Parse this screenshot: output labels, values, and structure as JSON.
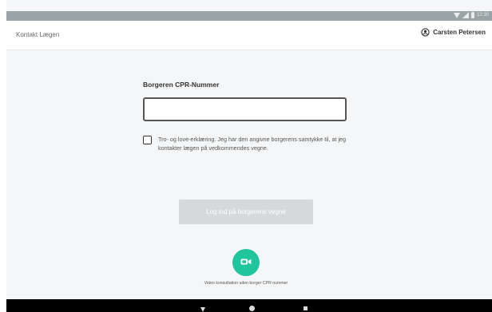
{
  "status_bar": {
    "time": "12:30"
  },
  "header": {
    "title": "Kontakt Lægen",
    "user_name": "Carsten Petersen"
  },
  "form": {
    "cpr_label": "Borgeren CPR-Nummer",
    "cpr_value": "",
    "consent_text": "Tro- og love-erklæring. Jeg har den angivne borgerens samtykke til, at jeg kontakter lægen på vedkommendes vegne.",
    "consent_checked": false,
    "login_button_label": "Log ind på borgerens vegne"
  },
  "video": {
    "caption": "Video konsultation uden borger CPR nummer"
  },
  "colors": {
    "accent": "#1fc59d",
    "disabled_button": "#d5d9dc",
    "status_bar": "#9aa3a5",
    "nav_bar": "#000000"
  },
  "icons": {
    "user": "account-circle-icon",
    "video": "video-camera-icon"
  }
}
